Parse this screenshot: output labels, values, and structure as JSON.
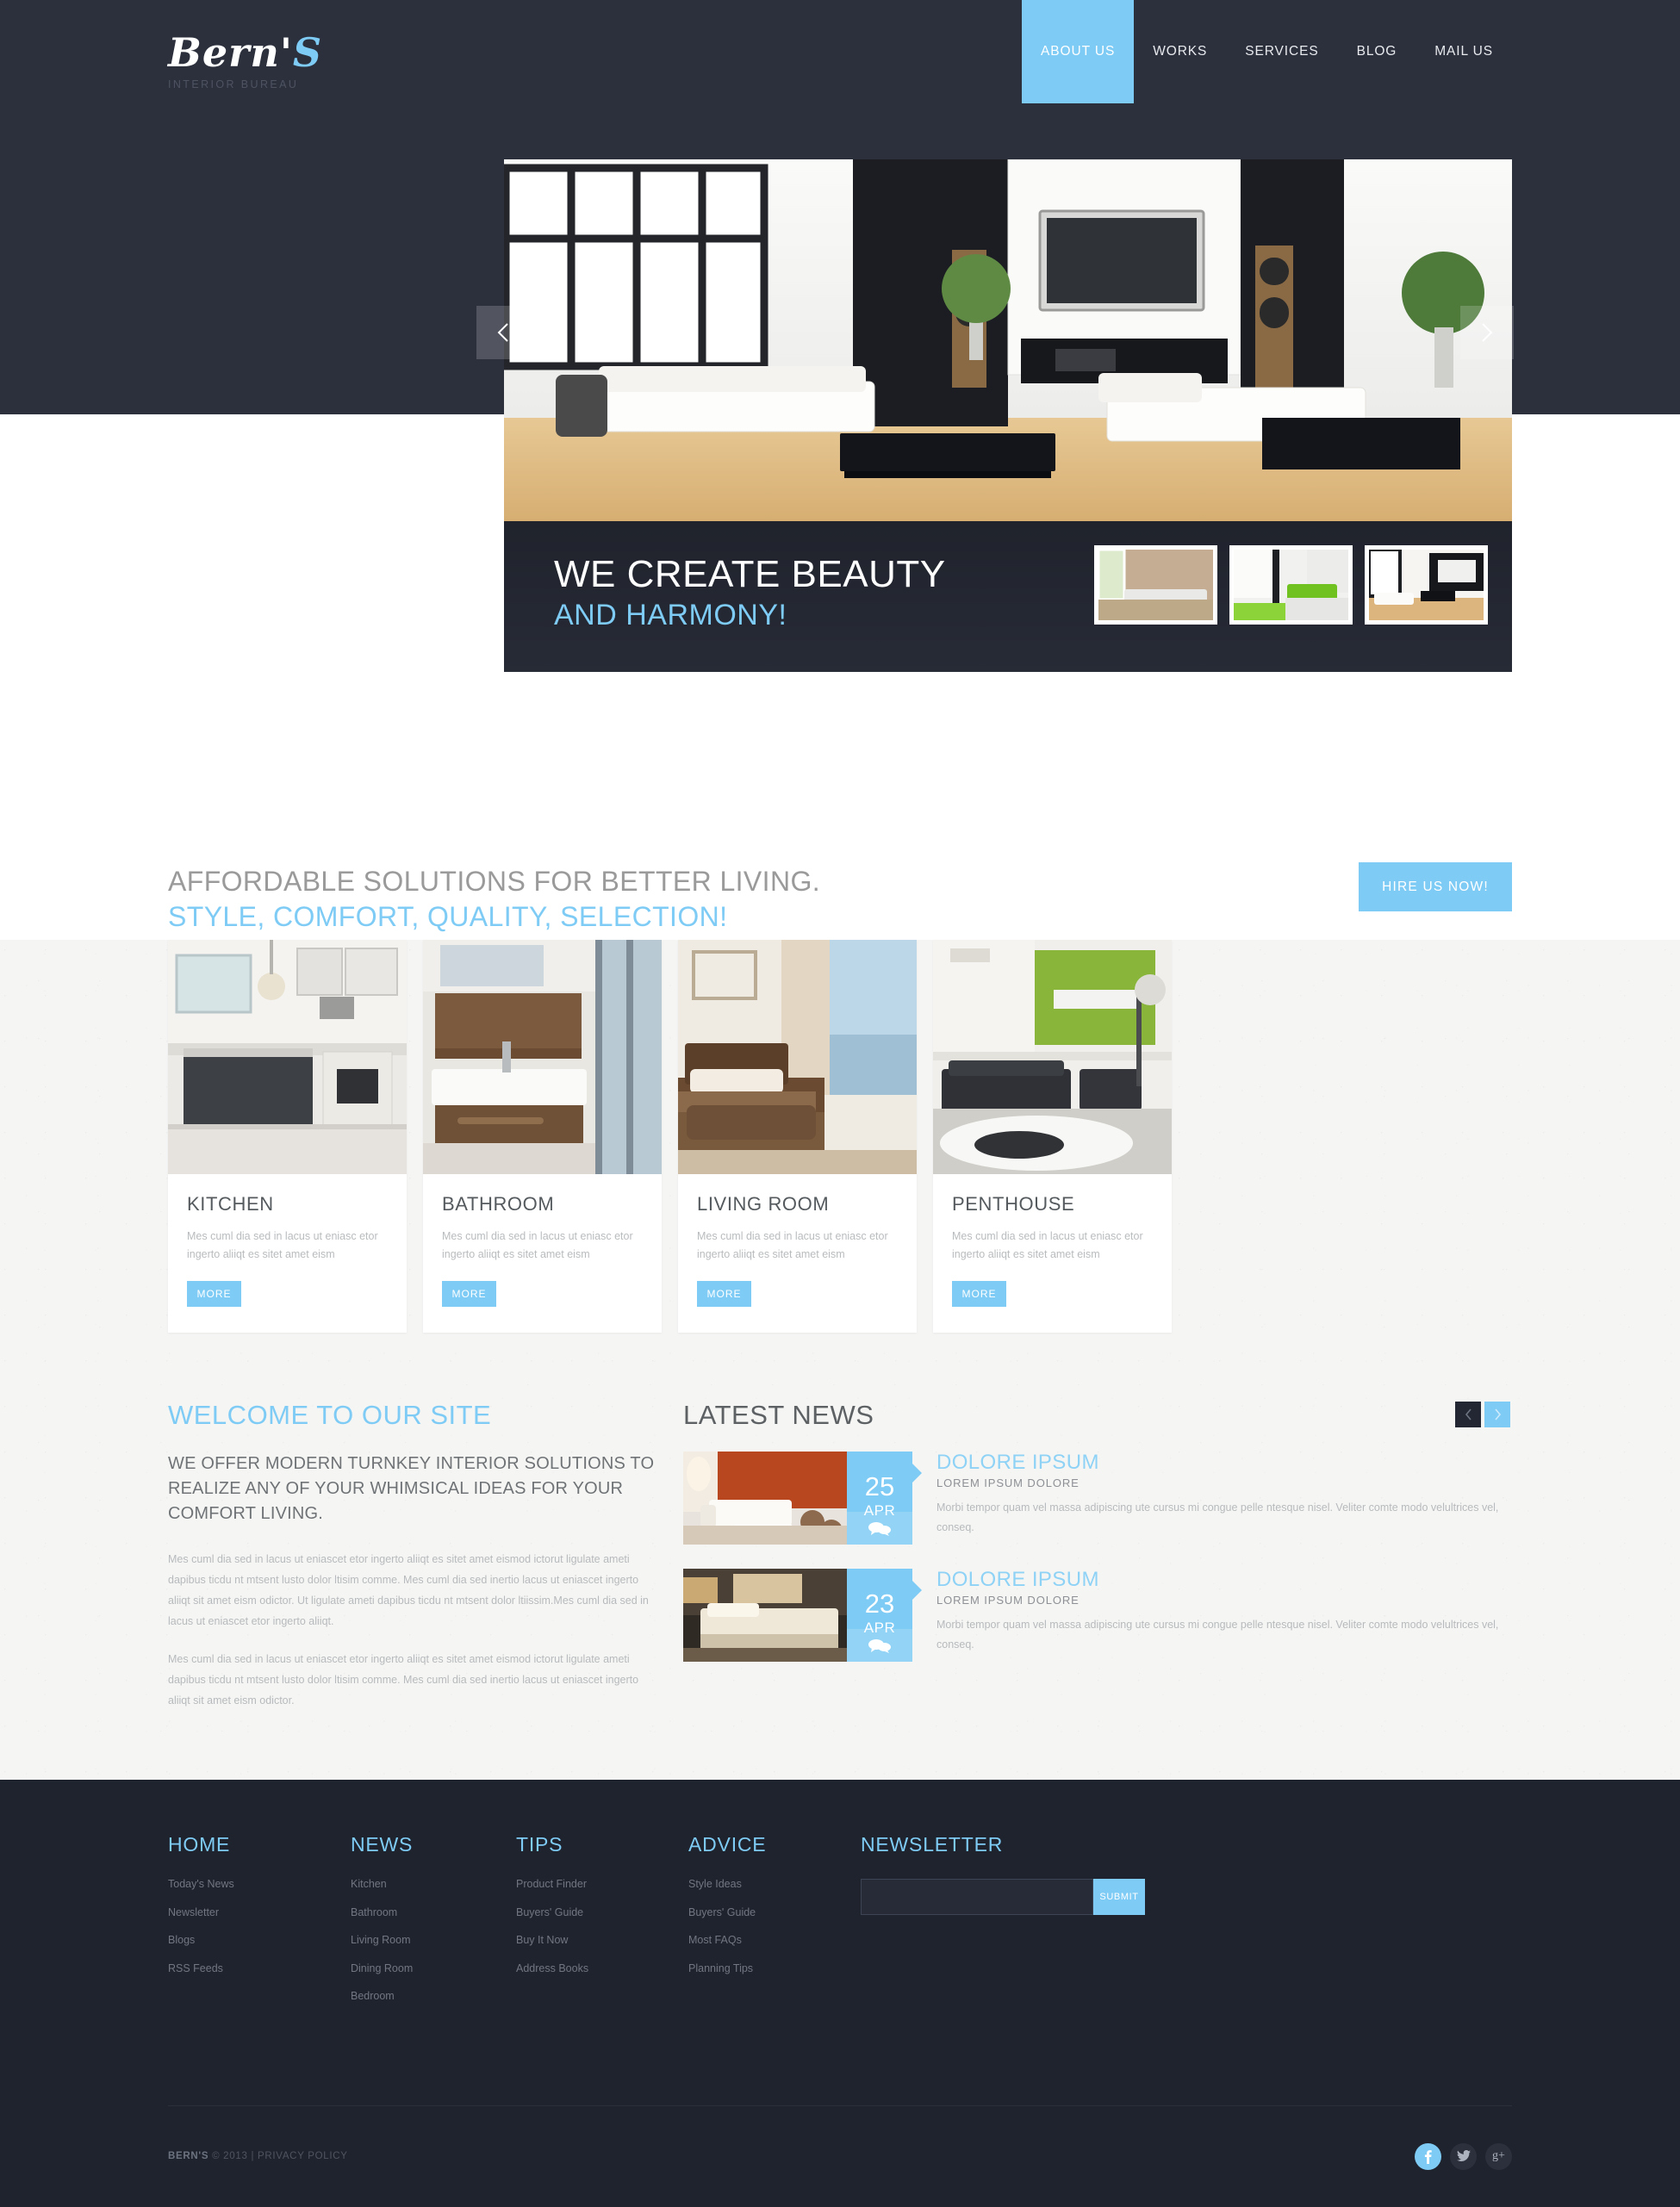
{
  "brand": {
    "logo_main": "Bern'",
    "logo_accent": "S",
    "logo_sub": "INTERIOR BUREAU"
  },
  "nav": {
    "items": [
      {
        "label": "ABOUT US",
        "active": true
      },
      {
        "label": "WORKS",
        "active": false
      },
      {
        "label": "SERVICES",
        "active": false
      },
      {
        "label": "BLOG",
        "active": false
      },
      {
        "label": "MAIL US",
        "active": false
      }
    ]
  },
  "hero": {
    "heading": "WE CREATE BEAUTY",
    "subheading": "AND HARMONY!",
    "prev_label": "‹",
    "next_label": "›",
    "thumbs": [
      {
        "alt": "beige-wall-living-room"
      },
      {
        "alt": "green-sofa-open-space"
      },
      {
        "alt": "white-tv-lounge"
      }
    ]
  },
  "tagline": {
    "line1": "AFFORDABLE SOLUTIONS FOR BETTER LIVING.",
    "line2": "STYLE, COMFORT, QUALITY, SELECTION!",
    "cta": "HIRE US NOW!"
  },
  "cards": [
    {
      "title": "KITCHEN",
      "text": "Mes cuml dia sed in lacus ut eniasc etor ingerto aliiqt es sitet amet eism",
      "more": "MORE"
    },
    {
      "title": "BATHROOM",
      "text": "Mes cuml dia sed in lacus ut eniasc etor ingerto aliiqt es sitet amet eism",
      "more": "MORE"
    },
    {
      "title": "LIVING ROOM",
      "text": "Mes cuml dia sed in lacus ut eniasc etor ingerto aliiqt es sitet amet eism",
      "more": "MORE"
    },
    {
      "title": "PENTHOUSE",
      "text": "Mes cuml dia sed in lacus ut eniasc etor ingerto aliiqt es sitet amet eism",
      "more": "MORE"
    }
  ],
  "welcome": {
    "title": "WELCOME TO OUR SITE",
    "lead": "WE OFFER MODERN TURNKEY INTERIOR SOLUTIONS TO REALIZE ANY OF YOUR WHIMSICAL IDEAS FOR YOUR COMFORT LIVING.",
    "paragraph1": "Mes cuml dia sed in lacus ut eniascet etor ingerto aliiqt es sitet amet eismod ictorut ligulate ameti dapibus ticdu nt mtsent lusto dolor ltisim comme. Mes cuml dia sed inertio lacus ut eniascet ingerto aliiqt sit amet eism odictor. Ut ligulate ameti dapibus ticdu nt mtsent dolor ltiissim.Mes cuml dia sed in lacus ut eniascet etor ingerto aliiqt.",
    "paragraph2": "Mes cuml dia sed in lacus ut eniascet etor ingerto aliiqt es sitet amet eismod ictorut ligulate ameti dapibus ticdu nt mtsent lusto dolor ltisim comme. Mes cuml dia sed inertio lacus ut eniascet ingerto aliiqt sit amet eism odictor."
  },
  "news": {
    "title": "LATEST NEWS",
    "prev_label": "‹",
    "next_label": "›",
    "items": [
      {
        "day": "25",
        "month": "APR",
        "title": "DOLORE IPSUM",
        "subtitle": "LOREM IPSUM DOLORE",
        "text": "Morbi tempor quam vel massa adipiscing ute cursus mi congue pelle ntesque nisel. Veliter comte modo velultrices vel, conseq.",
        "thumb_alt": "orange-wall-white-sofa"
      },
      {
        "day": "23",
        "month": "APR",
        "title": "DOLORE IPSUM",
        "subtitle": "LOREM IPSUM DOLORE",
        "text": "Morbi tempor quam vel massa adipiscing ute cursus mi congue pelle ntesque nisel. Veliter comte modo velultrices vel, conseq.",
        "thumb_alt": "warm-bedroom"
      }
    ]
  },
  "footer": {
    "columns": [
      {
        "heading": "HOME",
        "links": [
          "Today's News",
          "Newsletter",
          "Blogs",
          "RSS Feeds"
        ]
      },
      {
        "heading": "NEWS",
        "links": [
          "Kitchen",
          "Bathroom",
          "Living Room",
          "Dining Room",
          "Bedroom"
        ]
      },
      {
        "heading": "TIPS",
        "links": [
          "Product Finder",
          "Buyers' Guide",
          "Buy It Now",
          "Address Books"
        ]
      },
      {
        "heading": "ADVICE",
        "links": [
          "Style Ideas",
          "Buyers' Guide",
          "Most FAQs",
          "Planning Tips"
        ]
      }
    ],
    "newsletter": {
      "heading": "NEWSLETTER",
      "value": "",
      "placeholder": "",
      "submit": "SUBMIT"
    },
    "copyright_brand": "BERN'S",
    "copyright_rest": " © 2013 | PRIVACY POLICY",
    "socials": [
      {
        "name": "facebook",
        "glyph": "f",
        "active": true
      },
      {
        "name": "twitter",
        "glyph": "ᵀ",
        "active": false
      },
      {
        "name": "googleplus",
        "glyph": "g+",
        "active": false
      }
    ]
  },
  "colors": {
    "accent": "#7ecbf5",
    "dark": "#2c303d",
    "footer_dark": "#1f232e",
    "caption_dark": "#23262f"
  }
}
